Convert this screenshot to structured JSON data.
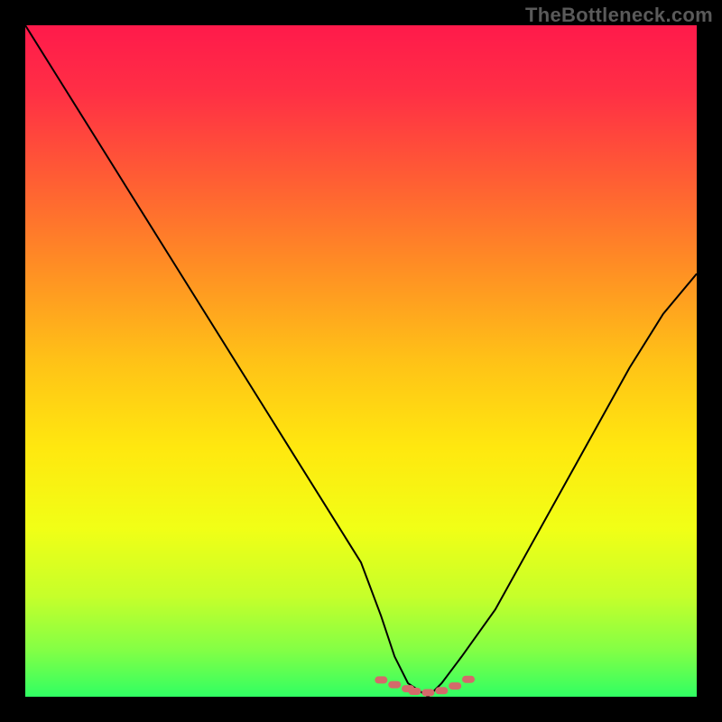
{
  "watermark": "TheBottleneck.com",
  "colors": {
    "background": "#000000",
    "curve": "#000000",
    "marker": "#d46a6a",
    "gradient_stops": [
      {
        "offset": 0.0,
        "color": "#ff1a4b"
      },
      {
        "offset": 0.1,
        "color": "#ff2f45"
      },
      {
        "offset": 0.22,
        "color": "#ff5a35"
      },
      {
        "offset": 0.35,
        "color": "#ff8a25"
      },
      {
        "offset": 0.5,
        "color": "#ffc217"
      },
      {
        "offset": 0.63,
        "color": "#ffe80f"
      },
      {
        "offset": 0.75,
        "color": "#f1ff16"
      },
      {
        "offset": 0.85,
        "color": "#c6ff2a"
      },
      {
        "offset": 0.93,
        "color": "#84ff45"
      },
      {
        "offset": 1.0,
        "color": "#30ff63"
      }
    ]
  },
  "chart_data": {
    "type": "line",
    "title": "",
    "xlabel": "",
    "ylabel": "",
    "xlim": [
      0,
      100
    ],
    "ylim": [
      0,
      100
    ],
    "series": [
      {
        "name": "bottleneck-curve",
        "x": [
          0,
          5,
          10,
          15,
          20,
          25,
          30,
          35,
          40,
          45,
          50,
          53,
          55,
          57,
          60,
          62,
          65,
          70,
          75,
          80,
          85,
          90,
          95,
          100
        ],
        "y": [
          100,
          92,
          84,
          76,
          68,
          60,
          52,
          44,
          36,
          28,
          20,
          12,
          6,
          2,
          0,
          2,
          6,
          13,
          22,
          31,
          40,
          49,
          57,
          63
        ]
      }
    ],
    "markers": {
      "name": "highlight-band",
      "x": [
        53,
        55,
        57,
        58,
        60,
        62,
        64,
        66
      ],
      "y": [
        2.5,
        1.8,
        1.2,
        0.8,
        0.6,
        0.9,
        1.6,
        2.6
      ]
    }
  }
}
